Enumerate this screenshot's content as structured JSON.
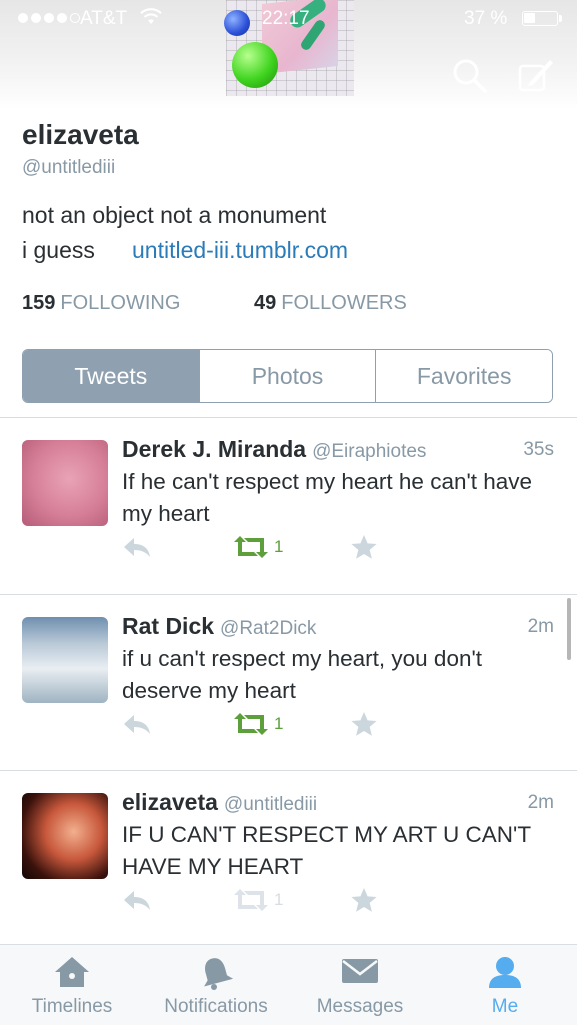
{
  "status_bar": {
    "carrier": "AT&T",
    "time": "22:17",
    "battery_percent": "37 %",
    "battery_level": 0.37,
    "signal_bars_filled": 4,
    "signal_bars_total": 5
  },
  "header": {
    "icons": [
      "search-icon",
      "compose-icon"
    ]
  },
  "profile": {
    "display_name": "elizaveta",
    "handle": "@untitlediii",
    "bio_line1": "not an object not a monument",
    "bio_line2": "i guess",
    "link": "untitled-iii.tumblr.com",
    "following_count": "159",
    "following_label": "FOLLOWING",
    "followers_count": "49",
    "followers_label": "FOLLOWERS"
  },
  "tabs": [
    {
      "label": "Tweets",
      "active": true
    },
    {
      "label": "Photos",
      "active": false
    },
    {
      "label": "Favorites",
      "active": false
    }
  ],
  "tweets": [
    {
      "name": "Derek J. Miranda",
      "handle": "@Eiraphiotes",
      "time": "35s",
      "text": "If he can't respect my heart he can't have my heart",
      "retweets": "1"
    },
    {
      "name": "Rat Dick",
      "handle": "@Rat2Dick",
      "time": "2m",
      "text": "if u can't respect my heart, you don't deserve my heart",
      "retweets": "1"
    },
    {
      "name": "elizaveta",
      "handle": "@untitlediii",
      "time": "2m",
      "text": "IF U CAN'T RESPECT MY ART U CAN'T HAVE MY HEART",
      "retweets": "1"
    }
  ],
  "tabbar": {
    "timelines": "Timelines",
    "notifications": "Notifications",
    "messages": "Messages",
    "me": "Me",
    "active": "Me"
  },
  "colors": {
    "accent_blue": "#55acee",
    "link_blue": "#2b7bb9",
    "retweet_green": "#5c9f3b",
    "tab_active_bg": "#8fa1b0",
    "muted_text": "#8899a6"
  }
}
